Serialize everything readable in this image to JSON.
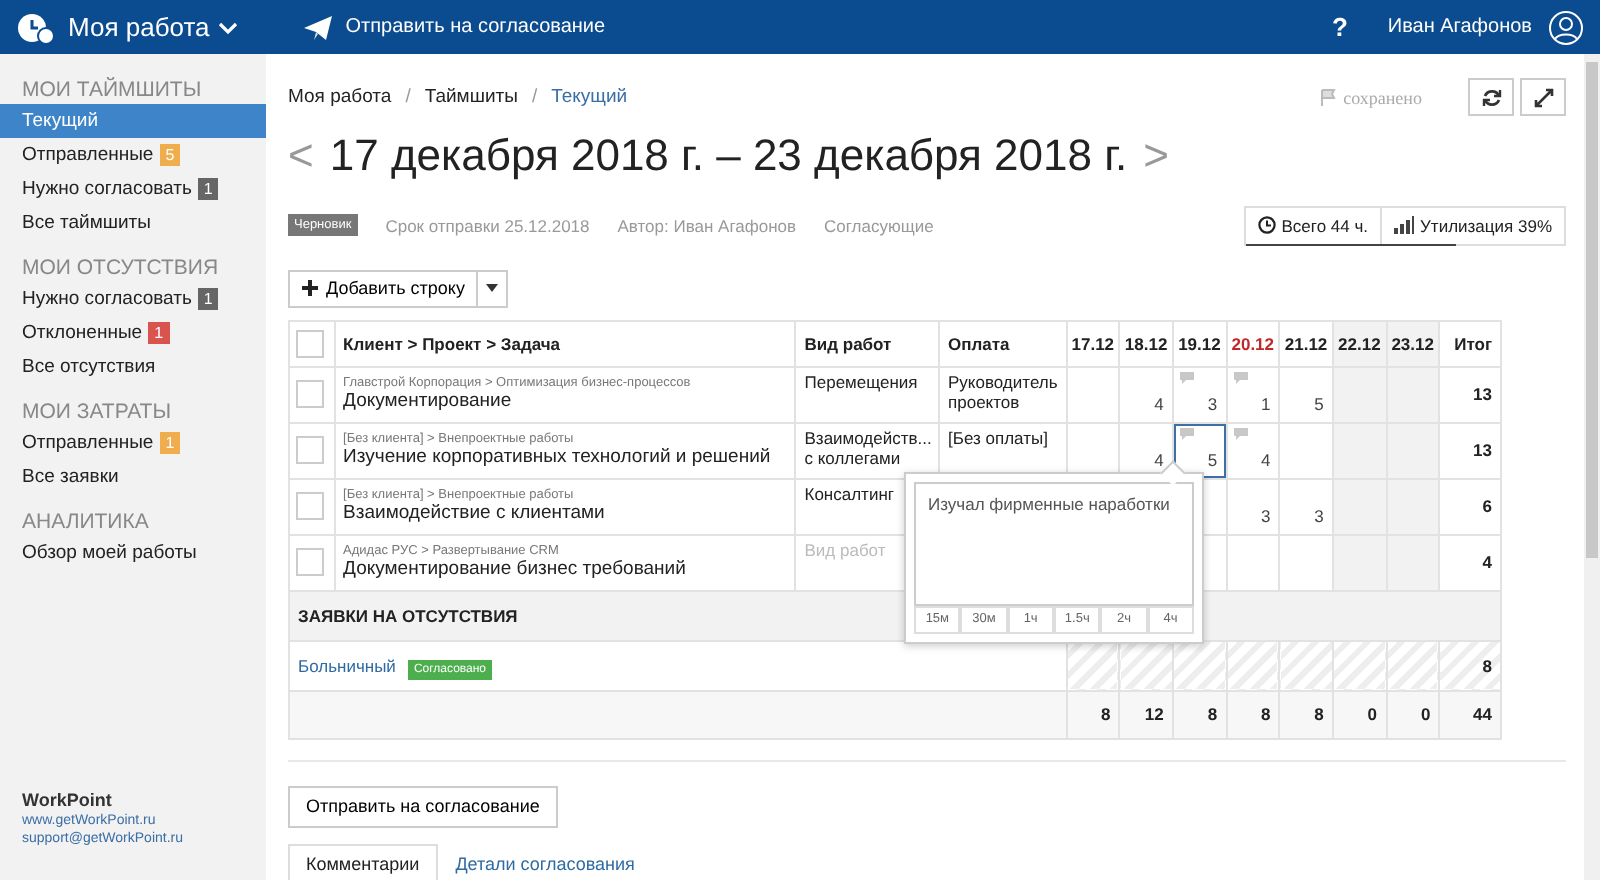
{
  "header": {
    "app_title": "Моя работа",
    "action": "Отправить на согласование",
    "help": "?",
    "user": "Иван Агафонов"
  },
  "sidebar": {
    "sections": [
      {
        "title": "МОИ ТАЙМШИТЫ",
        "items": [
          {
            "label": "Текущий",
            "selected": true
          },
          {
            "label": "Отправленные",
            "selected": false,
            "badge": {
              "text": "5",
              "color": "#f0ad4e"
            }
          },
          {
            "label": "Нужно согласовать",
            "selected": false,
            "badge": {
              "text": "1",
              "color": "#666666"
            }
          },
          {
            "label": "Все таймшиты",
            "selected": false
          }
        ]
      },
      {
        "title": "МОИ ОТСУТСТВИЯ",
        "items": [
          {
            "label": "Нужно согласовать",
            "selected": false,
            "badge": {
              "text": "1",
              "color": "#666666"
            }
          },
          {
            "label": "Отклоненные",
            "selected": false,
            "badge": {
              "text": "1",
              "color": "#d9534f"
            }
          },
          {
            "label": "Все отсутствия",
            "selected": false
          }
        ]
      },
      {
        "title": "МОИ ЗАТРАТЫ",
        "items": [
          {
            "label": "Отправленные",
            "selected": false,
            "badge": {
              "text": "1",
              "color": "#f0ad4e"
            }
          },
          {
            "label": "Все заявки",
            "selected": false
          }
        ]
      },
      {
        "title": "АНАЛИТИКА",
        "items": [
          {
            "label": "Обзор моей работы",
            "selected": false
          }
        ]
      }
    ],
    "footer": {
      "brand": "WorkPoint",
      "site": "www.getWorkPoint.ru",
      "email": "support@getWorkPoint.ru"
    }
  },
  "breadcrumb": [
    "Моя работа",
    "Таймшиты",
    "Текущий"
  ],
  "breadcrumb_separator": "/",
  "save_status": "сохранено",
  "period": {
    "prev": "<",
    "title": "17 декабря 2018 г. – 23 декабря 2018 г.",
    "next": ">"
  },
  "status_badge": "Черновик",
  "meta": [
    "Срок отправки 25.12.2018",
    "Автор: Иван Агафонов",
    "Согласующие"
  ],
  "summary": {
    "total": "Всего 44 ч.",
    "utilization": "Утилизация 39%",
    "level": 0.66
  },
  "add_row": "Добавить строку",
  "table": {
    "select_all_checked": false,
    "columns": {
      "task": "Клиент > Проект > Задача",
      "work_type": "Вид работ",
      "payment": "Оплата",
      "total": "Итог",
      "days": [
        {
          "label": "17.12",
          "weekend": false,
          "today": false
        },
        {
          "label": "18.12",
          "weekend": false,
          "today": false
        },
        {
          "label": "19.12",
          "weekend": false,
          "today": false
        },
        {
          "label": "20.12",
          "weekend": false,
          "today": true
        },
        {
          "label": "21.12",
          "weekend": false,
          "today": false
        },
        {
          "label": "22.12",
          "weekend": true,
          "today": false
        },
        {
          "label": "23.12",
          "weekend": true,
          "today": false
        }
      ]
    },
    "rows": [
      {
        "checked": false,
        "path": "Главстрой Корпорация > Оптимизация бизнес-процессов",
        "task": "Документирование",
        "work_type": "Перемещения",
        "payment": "Руководитель проектов",
        "total": "13",
        "cells": [
          {},
          {
            "value": "4",
            "comment": false,
            "selected": false
          },
          {
            "value": "3",
            "comment": true,
            "selected": false
          },
          {
            "value": "1",
            "comment": true,
            "selected": false
          },
          {
            "value": "5",
            "comment": false,
            "selected": false
          },
          {},
          {}
        ]
      },
      {
        "checked": false,
        "path": "[Без клиента] > Внепроектные работы",
        "task": "Изучение корпоративных технологий и решений",
        "work_type": "Взаимодейств... с коллегами",
        "payment": "[Без оплаты]",
        "total": "13",
        "cells": [
          {},
          {
            "value": "4",
            "comment": false,
            "selected": false
          },
          {
            "value": "5",
            "comment": true,
            "selected": true
          },
          {
            "value": "4",
            "comment": true,
            "selected": false
          },
          {},
          {},
          {}
        ]
      },
      {
        "checked": false,
        "path": "[Без клиента] > Внепроектные работы",
        "task": "Взаимодействие с клиентами",
        "work_type": "Консалтинг",
        "total": "6",
        "cells": [
          {},
          {},
          {},
          {
            "value": "3",
            "comment": false,
            "selected": false
          },
          {
            "value": "3",
            "comment": false,
            "selected": false
          },
          {},
          {}
        ]
      },
      {
        "checked": false,
        "path": "Адидас РУС > Развертывание CRM",
        "task": "Документирование бизнес требований",
        "work_type_placeholder": "Вид работ",
        "total": "4",
        "cells": [
          {},
          {},
          {},
          {},
          {},
          {},
          {}
        ]
      }
    ],
    "absence_section": "ЗАЯВКИ НА ОТСУТСТВИЯ",
    "absences": [
      {
        "type": "Больничный",
        "status": "Согласовано",
        "total": "8"
      }
    ],
    "totals": [
      "8",
      "12",
      "8",
      "8",
      "8",
      "0",
      "0",
      "44"
    ]
  },
  "comment_popover": {
    "text": "Изучал фирменные наработки",
    "durations": [
      "15м",
      "30м",
      "1ч",
      "1.5ч",
      "2ч",
      "4ч"
    ]
  },
  "submit": "Отправить на согласование",
  "tabs": [
    {
      "label": "Комментарии",
      "selected": true
    },
    {
      "label": "Детали согласования",
      "selected": false
    }
  ]
}
